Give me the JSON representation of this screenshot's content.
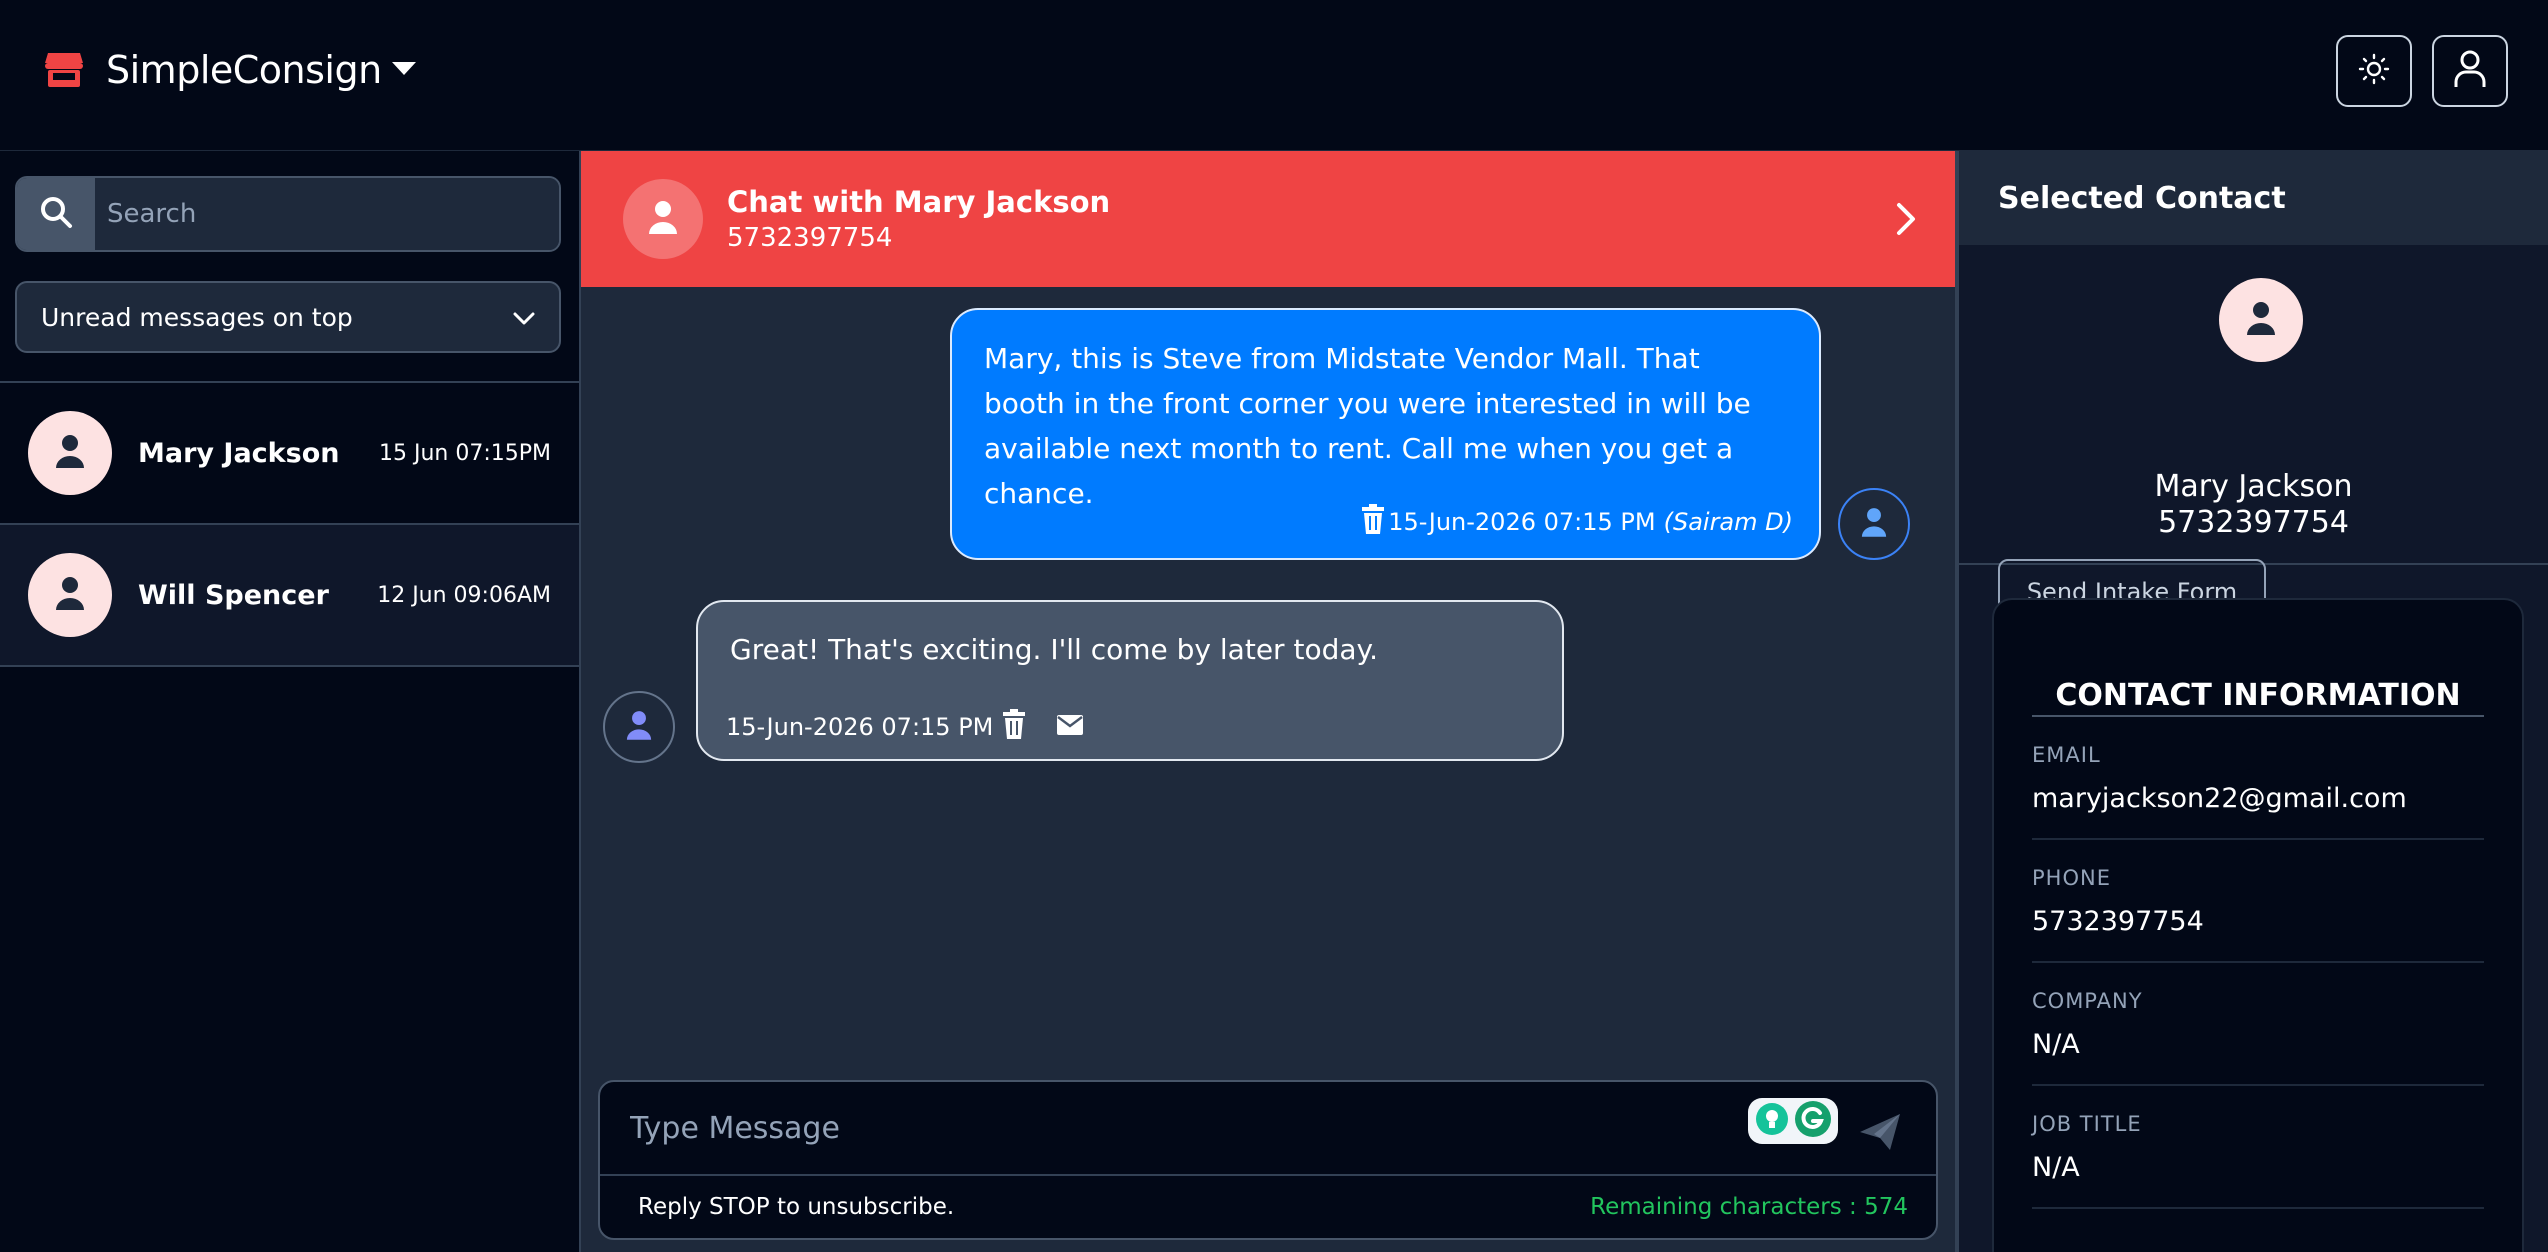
{
  "header": {
    "app_name": "SimpleConsign",
    "accent_color": "#ef4444",
    "icons": [
      "store-icon",
      "caret-down-icon",
      "sun-icon",
      "user-icon"
    ]
  },
  "sidebar": {
    "search": {
      "placeholder": "Search"
    },
    "sort": {
      "selected": "Unread messages on top"
    },
    "contacts": [
      {
        "name": "Mary Jackson",
        "time": "15 Jun 07:15PM",
        "active": true
      },
      {
        "name": "Will Spencer",
        "time": "12 Jun 09:06AM",
        "active": false
      }
    ]
  },
  "chat": {
    "title": "Chat with Mary Jackson",
    "phone": "5732397754",
    "header_color": "#ef4444",
    "messages": [
      {
        "direction": "outgoing",
        "text": "Mary, this is Steve from Midstate Vendor Mall. That booth in the front corner you were interested in will be available next month to rent. Call me when you get a chance.",
        "timestamp": "15-Jun-2026 07:15 PM",
        "sender": "(Sairam D)",
        "bubble_color": "#007bff"
      },
      {
        "direction": "incoming",
        "text": "Great! That's exciting. I'll come by later today.",
        "timestamp": "15-Jun-2026 07:15 PM",
        "bubble_color": "#475569"
      }
    ],
    "composer": {
      "placeholder": "Type Message",
      "footer_note": "Reply STOP to unsubscribe.",
      "remaining": "Remaining characters : 574",
      "remaining_color": "#22c55e"
    }
  },
  "right_panel": {
    "heading": "Selected Contact",
    "contact_name": "Mary Jackson",
    "contact_phone": "5732397754",
    "intake_button": "Send Intake Form",
    "info_title": "CONTACT INFORMATION",
    "fields": [
      {
        "label": "EMAIL",
        "value": "maryjackson22@gmail.com"
      },
      {
        "label": "PHONE",
        "value": "5732397754"
      },
      {
        "label": "COMPANY",
        "value": "N/A"
      },
      {
        "label": "JOB TITLE",
        "value": "N/A"
      }
    ]
  }
}
